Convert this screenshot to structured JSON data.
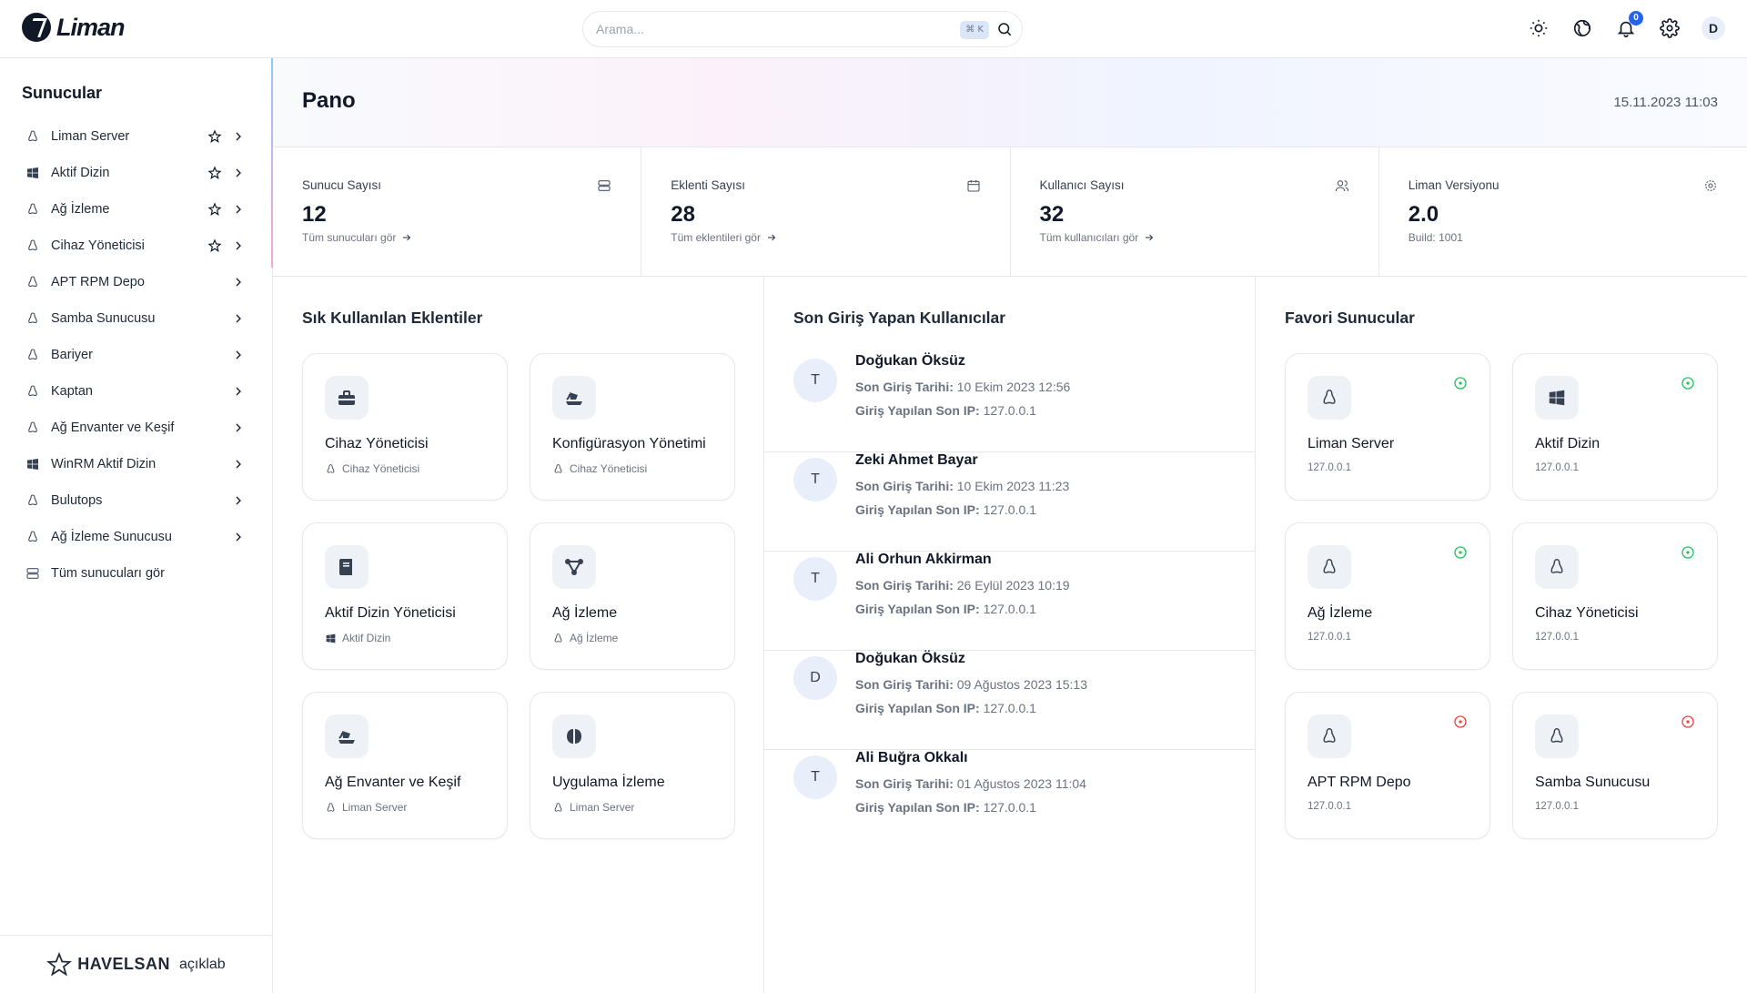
{
  "header": {
    "logo_text": "Liman",
    "search_placeholder": "Arama...",
    "search_shortcut": "⌘ K",
    "notification_count": "0",
    "avatar_initial": "D"
  },
  "sidebar": {
    "title": "Sunucular",
    "items": [
      {
        "label": "Liman Server",
        "icon": "linux-icon",
        "star": true
      },
      {
        "label": "Aktif Dizin",
        "icon": "windows-icon",
        "star": true
      },
      {
        "label": "Ağ İzleme",
        "icon": "linux-icon",
        "star": true
      },
      {
        "label": "Cihaz Yöneticisi",
        "icon": "linux-icon",
        "star": true
      },
      {
        "label": "APT RPM Depo",
        "icon": "linux-icon",
        "star": false
      },
      {
        "label": "Samba Sunucusu",
        "icon": "linux-icon",
        "star": false
      },
      {
        "label": "Bariyer",
        "icon": "linux-icon",
        "star": false
      },
      {
        "label": "Kaptan",
        "icon": "linux-icon",
        "star": false
      },
      {
        "label": "Ağ Envanter ve Keşif",
        "icon": "linux-icon",
        "star": false
      },
      {
        "label": "WinRM Aktif Dizin",
        "icon": "windows-icon",
        "star": false
      },
      {
        "label": "Bulutops",
        "icon": "linux-icon",
        "star": false
      },
      {
        "label": "Ağ İzleme Sunucusu",
        "icon": "linux-icon",
        "star": false
      }
    ],
    "all_servers_label": "Tüm sunucuları gör",
    "footer_brand": "HAVELSAN",
    "footer_sub": "açıklab"
  },
  "page": {
    "title": "Pano",
    "date": "15.11.2023 11:03"
  },
  "stats": [
    {
      "label": "Sunucu Sayısı",
      "value": "12",
      "link": "Tüm sunucuları gör",
      "icon": "server-icon"
    },
    {
      "label": "Eklenti Sayısı",
      "value": "28",
      "link": "Tüm eklentileri gör",
      "icon": "calendar-icon"
    },
    {
      "label": "Kullanıcı Sayısı",
      "value": "32",
      "link": "Tüm kullanıcıları gör",
      "icon": "users-icon"
    },
    {
      "label": "Liman Versiyonu",
      "value": "2.0",
      "link": "Build: 1001",
      "icon": "gear-icon"
    }
  ],
  "extensions": {
    "title": "Sık Kullanılan Eklentiler",
    "items": [
      {
        "name": "Cihaz Yöneticisi",
        "server": "Cihaz Yöneticisi",
        "icon": "toolbox-icon",
        "server_icon": "linux-icon"
      },
      {
        "name": "Konfigürasyon Yönetimi",
        "server": "Cihaz Yöneticisi",
        "icon": "ship-icon",
        "server_icon": "linux-icon"
      },
      {
        "name": "Aktif Dizin Yöneticisi",
        "server": "Aktif Dizin",
        "icon": "book-icon",
        "server_icon": "windows-icon"
      },
      {
        "name": "Ağ İzleme",
        "server": "Ağ İzleme",
        "icon": "network-icon",
        "server_icon": "linux-icon"
      },
      {
        "name": "Ağ Envanter ve Keşif",
        "server": "Liman Server",
        "icon": "ship-icon",
        "server_icon": "linux-icon"
      },
      {
        "name": "Uygulama İzleme",
        "server": "Liman Server",
        "icon": "brain-icon",
        "server_icon": "linux-icon"
      }
    ]
  },
  "users": {
    "title": "Son Giriş Yapan Kullanıcılar",
    "date_key": "Son Giriş Tarihi:",
    "ip_key": "Giriş Yapılan Son IP:",
    "items": [
      {
        "initial": "T",
        "name": "Doğukan Öksüz",
        "date": "10 Ekim 2023 12:56",
        "ip": "127.0.0.1"
      },
      {
        "initial": "T",
        "name": "Zeki Ahmet Bayar",
        "date": "10 Ekim 2023 11:23",
        "ip": "127.0.0.1"
      },
      {
        "initial": "T",
        "name": "Ali Orhun Akkirman",
        "date": "26 Eylül 2023 10:19",
        "ip": "127.0.0.1"
      },
      {
        "initial": "D",
        "name": "Doğukan Öksüz",
        "date": "09 Ağustos 2023 15:13",
        "ip": "127.0.0.1"
      },
      {
        "initial": "T",
        "name": "Ali Buğra Okkalı",
        "date": "01 Ağustos 2023 11:04",
        "ip": "127.0.0.1"
      }
    ]
  },
  "favorites": {
    "title": "Favori Sunucular",
    "items": [
      {
        "name": "Liman Server",
        "ip": "127.0.0.1",
        "icon": "linux-icon",
        "status": "online"
      },
      {
        "name": "Aktif Dizin",
        "ip": "127.0.0.1",
        "icon": "windows-icon",
        "status": "online"
      },
      {
        "name": "Ağ İzleme",
        "ip": "127.0.0.1",
        "icon": "linux-icon",
        "status": "online"
      },
      {
        "name": "Cihaz Yöneticisi",
        "ip": "127.0.0.1",
        "icon": "linux-icon",
        "status": "online"
      },
      {
        "name": "APT RPM Depo",
        "ip": "127.0.0.1",
        "icon": "linux-icon",
        "status": "offline"
      },
      {
        "name": "Samba Sunucusu",
        "ip": "127.0.0.1",
        "icon": "linux-icon",
        "status": "offline"
      }
    ]
  },
  "colors": {
    "online": "#22c55e",
    "offline": "#ef4444",
    "accent": "#2563eb"
  }
}
